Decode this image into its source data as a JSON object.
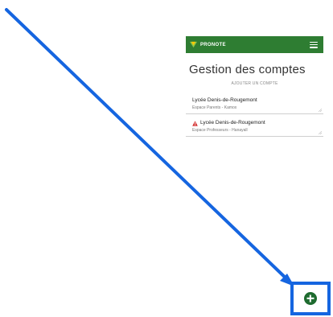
{
  "header": {
    "brand_name": "PRONOTE",
    "brand_icon": "pronote-logo-icon",
    "menu_icon": "hamburger-menu-icon",
    "color": "#2e7d32"
  },
  "page": {
    "title": "Gestion des comptes",
    "add_account_label": "AJOUTER UN COMPTE"
  },
  "accounts": [
    {
      "school": "Lycée Denis-de-Rougemont",
      "space": "Espace Parents - Kamox",
      "warning": false
    },
    {
      "school": "Lycée Denis-de-Rougemont",
      "space": "Espace Professeurs - Hanayall",
      "warning": true
    }
  ],
  "annotation": {
    "arrow_color": "#1565e0",
    "highlight_color": "#1565e0",
    "target_icon": "add-circle-icon",
    "target_color": "#1e6b2f"
  }
}
